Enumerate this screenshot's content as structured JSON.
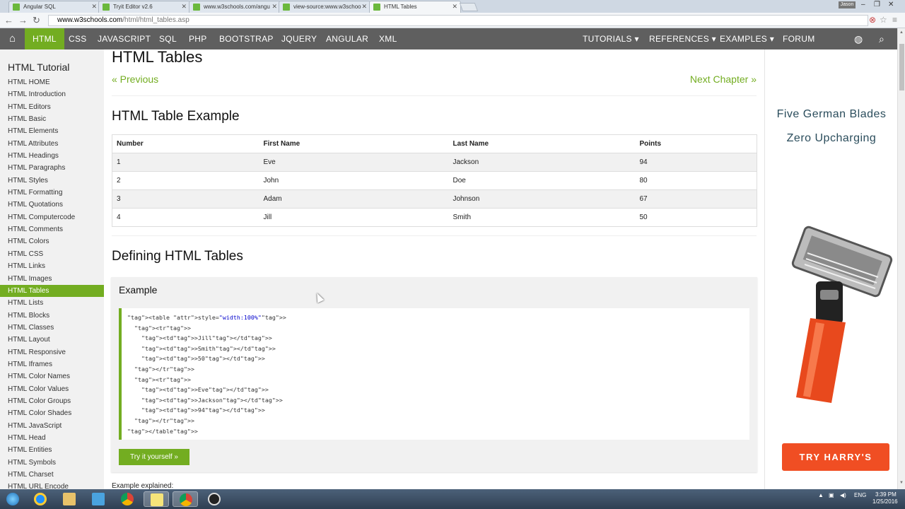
{
  "browser": {
    "tabs": [
      {
        "title": "Angular SQL",
        "active": false
      },
      {
        "title": "Tryit Editor v2.6",
        "active": false
      },
      {
        "title": "www.w3schools.com/angu",
        "active": false
      },
      {
        "title": "view-source:www.w3schoo",
        "active": false
      },
      {
        "title": "HTML Tables",
        "active": true
      }
    ],
    "user_badge": "Jason",
    "url_domain": "www.w3schools.com",
    "url_path": "/html/html_tables.asp"
  },
  "topnav": {
    "items": [
      "HTML",
      "CSS",
      "JAVASCRIPT",
      "SQL",
      "PHP",
      "BOOTSTRAP",
      "JQUERY",
      "ANGULAR",
      "XML"
    ],
    "right_items": [
      "TUTORIALS ▾",
      "REFERENCES ▾",
      "EXAMPLES ▾",
      "FORUM"
    ],
    "active": "HTML"
  },
  "sidebar": {
    "heading": "HTML Tutorial",
    "links": [
      "HTML HOME",
      "HTML Introduction",
      "HTML Editors",
      "HTML Basic",
      "HTML Elements",
      "HTML Attributes",
      "HTML Headings",
      "HTML Paragraphs",
      "HTML Styles",
      "HTML Formatting",
      "HTML Quotations",
      "HTML Computercode",
      "HTML Comments",
      "HTML Colors",
      "HTML CSS",
      "HTML Links",
      "HTML Images",
      "HTML Tables",
      "HTML Lists",
      "HTML Blocks",
      "HTML Classes",
      "HTML Layout",
      "HTML Responsive",
      "HTML Iframes",
      "HTML Color Names",
      "HTML Color Values",
      "HTML Color Groups",
      "HTML Color Shades",
      "HTML JavaScript",
      "HTML Head",
      "HTML Entities",
      "HTML Symbols",
      "HTML Charset",
      "HTML URL Encode"
    ],
    "active": "HTML Tables"
  },
  "main": {
    "title": "HTML Tables",
    "prev": "« Previous",
    "next": "Next Chapter »",
    "table_heading": "HTML Table Example",
    "table": {
      "headers": [
        "Number",
        "First Name",
        "Last Name",
        "Points"
      ],
      "rows": [
        [
          "1",
          "Eve",
          "Jackson",
          "94"
        ],
        [
          "2",
          "John",
          "Doe",
          "80"
        ],
        [
          "3",
          "Adam",
          "Johnson",
          "67"
        ],
        [
          "4",
          "Jill",
          "Smith",
          "50"
        ]
      ]
    },
    "defining_heading": "Defining HTML Tables",
    "example_title": "Example",
    "code_lines": [
      "<table style=\"width:100%\">",
      "  <tr>",
      "    <td>Jill</td>",
      "    <td>Smith</td>",
      "    <td>50</td>",
      "  </tr>",
      "  <tr>",
      "    <td>Eve</td>",
      "    <td>Jackson</td>",
      "    <td>94</td>",
      "  </tr>",
      "</table>"
    ],
    "try_button": "Try it yourself »",
    "explained": "Example explained:"
  },
  "ad": {
    "line1": "Five German Blades",
    "line2": "Zero Upcharging",
    "cta": "TRY HARRY'S"
  },
  "taskbar": {
    "lang": "ENG",
    "time": "3:39 PM",
    "date": "1/25/2016"
  },
  "colors": {
    "accent": "#73ad21",
    "nav_bg": "#5f5f5f",
    "ad_cta": "#f04e23"
  }
}
